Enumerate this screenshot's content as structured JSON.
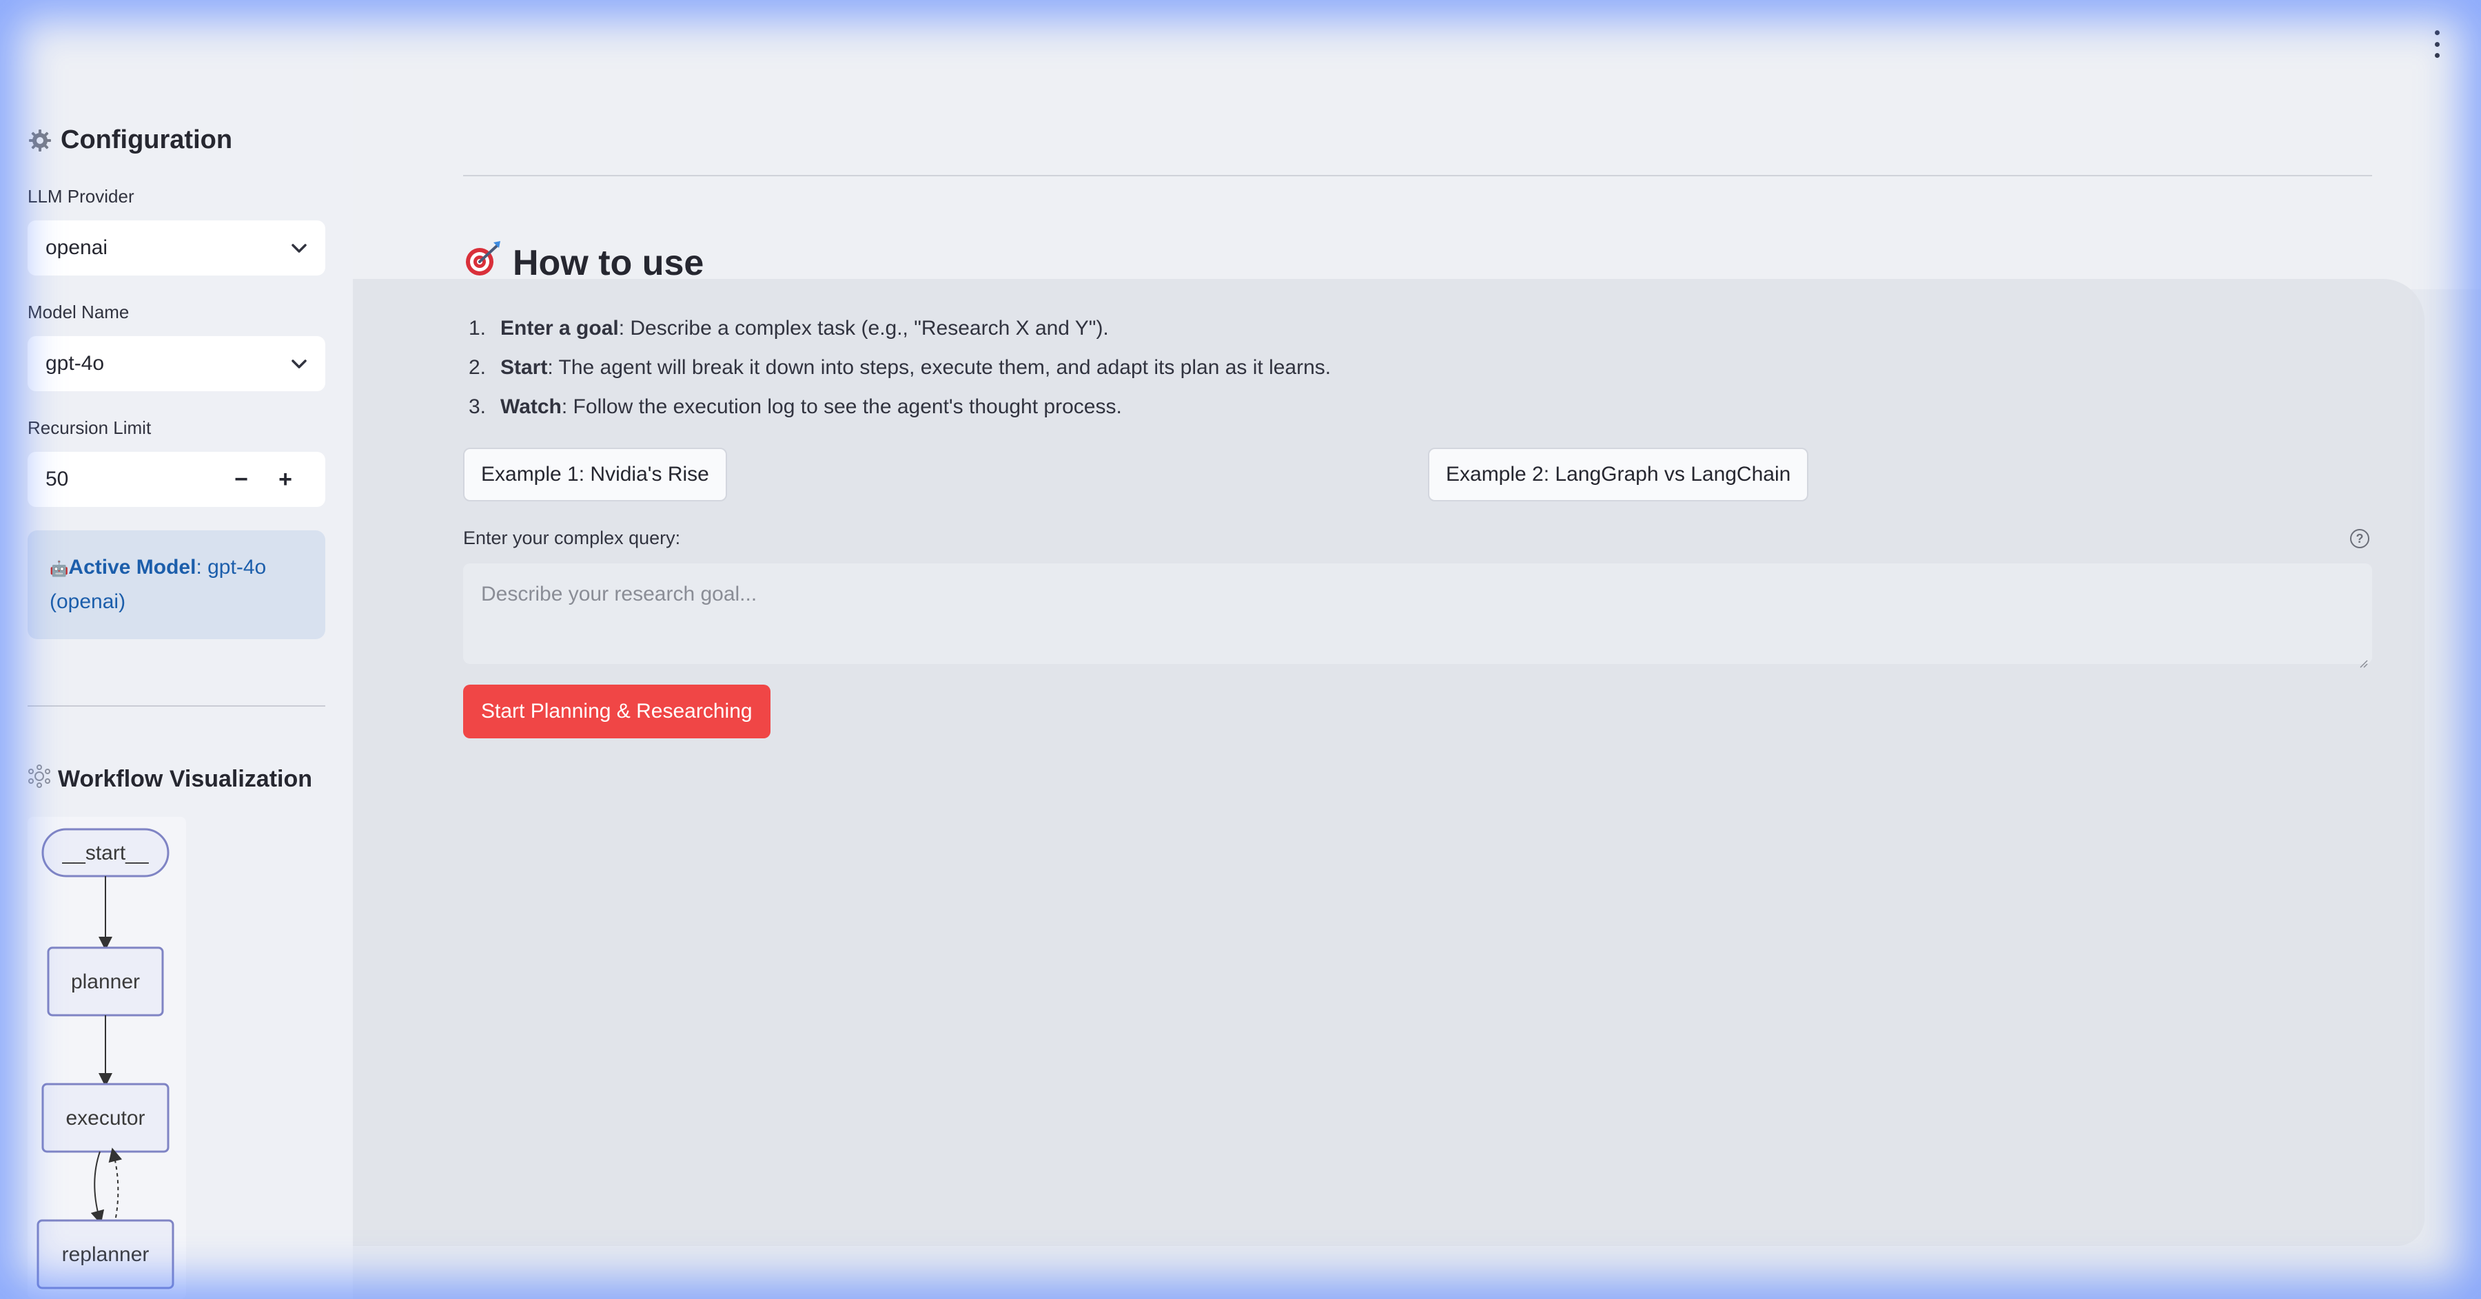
{
  "sidebar": {
    "title": "Configuration",
    "llm_provider": {
      "label": "LLM Provider",
      "value": "openai"
    },
    "model_name": {
      "label": "Model Name",
      "value": "gpt-4o"
    },
    "recursion_limit": {
      "label": "Recursion Limit",
      "value": "50",
      "minus": "−",
      "plus": "+"
    },
    "info": {
      "emoji": "🤖",
      "bold": "Active Model",
      "text": ": gpt-4o (openai)"
    },
    "workflow_title": "Workflow Visualization",
    "graph_nodes": [
      "__start__",
      "planner",
      "executor",
      "replanner"
    ]
  },
  "main": {
    "heading": "How to use",
    "steps": [
      {
        "num": "1.",
        "bold": "Enter a goal",
        "text": ": Describe a complex task (e.g., \"Research X and Y\")."
      },
      {
        "num": "2.",
        "bold": "Start",
        "text": ": The agent will break it down into steps, execute them, and adapt its plan as it learns."
      },
      {
        "num": "3.",
        "bold": "Watch",
        "text": ": Follow the execution log to see the agent's thought process."
      }
    ],
    "example1": "Example 1: Nvidia's Rise",
    "example2": "Example 2: LangGraph vs LangChain",
    "query_label": "Enter your complex query:",
    "help_glyph": "?",
    "query_placeholder": "Describe your research goal...",
    "start_button": "Start Planning & Researching"
  },
  "colors": {
    "primary": "#f04646",
    "info_text": "#1c5eab",
    "info_bg": "#d8e1ef",
    "glow": "#5884ff"
  },
  "icons": {
    "config": "gear-icon",
    "workflow": "network-icon",
    "heading": "target-icon",
    "menu": "kebab-menu-icon"
  }
}
